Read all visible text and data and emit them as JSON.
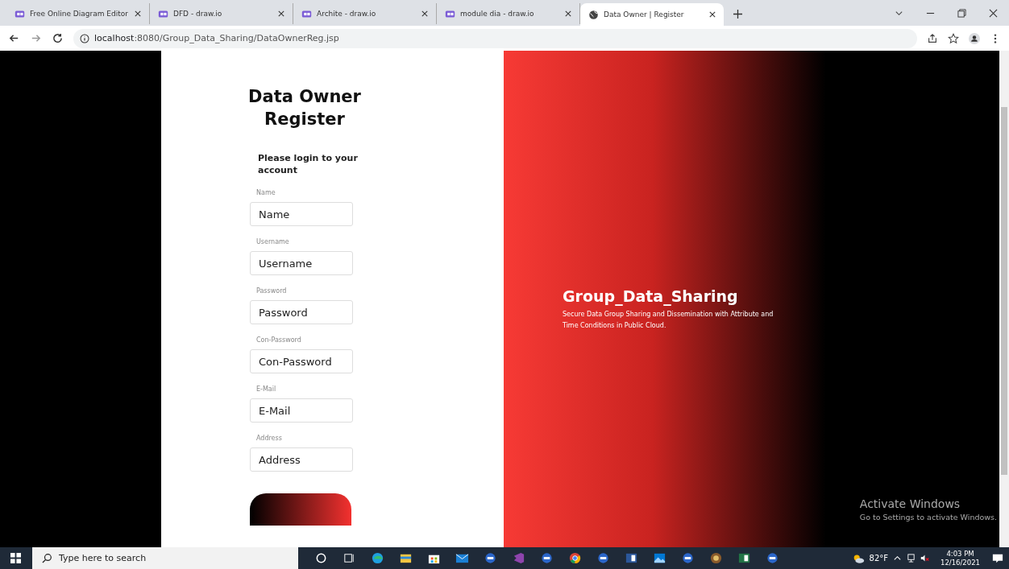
{
  "browser": {
    "tabs": [
      {
        "title": "Free Online Diagram Editor",
        "kind": "drawio",
        "selected": false
      },
      {
        "title": "DFD - draw.io",
        "kind": "drawio",
        "selected": false
      },
      {
        "title": "Archite - draw.io",
        "kind": "drawio",
        "selected": false
      },
      {
        "title": "module dia - draw.io",
        "kind": "drawio",
        "selected": false
      },
      {
        "title": "Data Owner | Register",
        "kind": "globe",
        "selected": true
      }
    ],
    "url_host": "localhost",
    "url_rest": ":8080/Group_Data_Sharing/DataOwnerReg.jsp"
  },
  "form": {
    "title": "Data Owner Register",
    "subtitle": "Please login to your account",
    "fields": [
      {
        "label": "Name",
        "placeholder": "Name"
      },
      {
        "label": "Username",
        "placeholder": "Username"
      },
      {
        "label": "Password",
        "placeholder": "Password"
      },
      {
        "label": "Con-Password",
        "placeholder": "Con-Password"
      },
      {
        "label": "E-Mail",
        "placeholder": "E-Mail"
      },
      {
        "label": "Address",
        "placeholder": "Address"
      }
    ]
  },
  "hero": {
    "title": "Group_Data_Sharing",
    "text": "Secure Data Group Sharing and Dissemination with Attribute and Time Conditions in Public Cloud."
  },
  "activation": {
    "title": "Activate Windows",
    "text": "Go to Settings to activate Windows."
  },
  "taskbar": {
    "search_placeholder": "Type here to search",
    "apps": [
      {
        "kind": "cortana"
      },
      {
        "kind": "taskview"
      },
      {
        "kind": "edge"
      },
      {
        "kind": "folder"
      },
      {
        "kind": "store"
      },
      {
        "kind": "mail"
      },
      {
        "kind": "app"
      },
      {
        "kind": "vs"
      },
      {
        "kind": "app"
      },
      {
        "kind": "chrome"
      },
      {
        "kind": "app"
      },
      {
        "kind": "word"
      },
      {
        "kind": "photos"
      },
      {
        "kind": "app"
      },
      {
        "kind": "game"
      },
      {
        "kind": "excel"
      },
      {
        "kind": "app"
      }
    ],
    "weather": "82°F",
    "time": "4:03 PM",
    "date": "12/16/2021"
  }
}
